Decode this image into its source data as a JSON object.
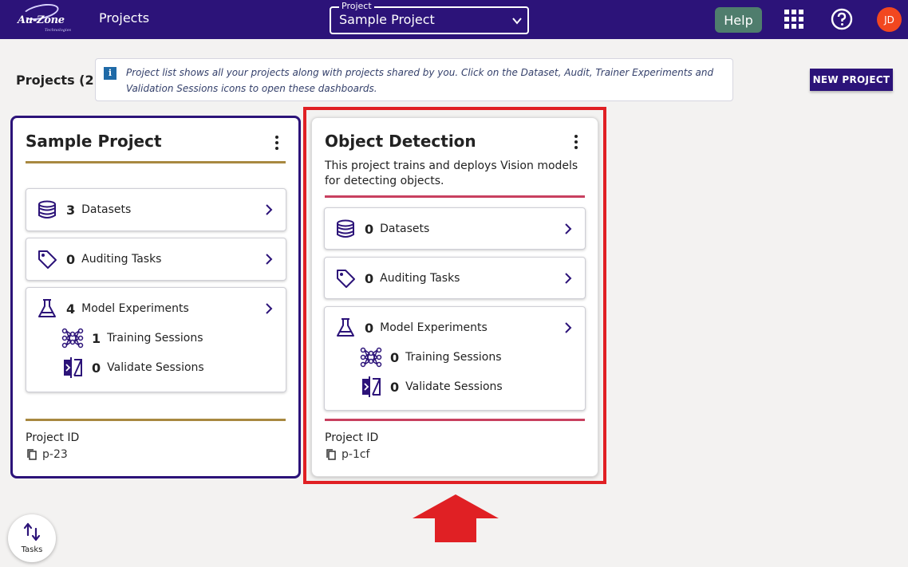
{
  "topbar": {
    "logo_text": "Au-Zone",
    "logo_sub": "Technologies",
    "nav_title": "Projects",
    "project_select_legend": "Project",
    "project_select_value": "Sample Project",
    "help_label": "Help",
    "avatar_initials": "JD",
    "bar_color": "#2c1379",
    "help_color": "#4f7d6d",
    "avatar_color": "#f2471f"
  },
  "header": {
    "projects_count": "Projects (2)",
    "info_text": "Project list shows all your projects along with projects shared by you. Click on the Dataset, Audit, Trainer Experiments and Validation Sessions icons to open these dashboards.",
    "new_project_label": "NEW PROJECT"
  },
  "cards": [
    {
      "title": "Sample Project",
      "description": "",
      "rule_color": "#a88840",
      "datasets": {
        "count": "3",
        "label": "Datasets"
      },
      "auditing": {
        "count": "0",
        "label": "Auditing Tasks"
      },
      "experiments": {
        "count": "4",
        "label": "Model Experiments"
      },
      "training": {
        "count": "1",
        "label": "Training Sessions"
      },
      "validate": {
        "count": "0",
        "label": "Validate Sessions"
      },
      "project_id_label": "Project ID",
      "project_id": "p-23"
    },
    {
      "title": "Object Detection",
      "description": "This project trains and deploys Vision models for detecting objects.",
      "rule_color": "#c8405f",
      "datasets": {
        "count": "0",
        "label": "Datasets"
      },
      "auditing": {
        "count": "0",
        "label": "Auditing Tasks"
      },
      "experiments": {
        "count": "0",
        "label": "Model Experiments"
      },
      "training": {
        "count": "0",
        "label": "Training Sessions"
      },
      "validate": {
        "count": "0",
        "label": "Validate Sessions"
      },
      "project_id_label": "Project ID",
      "project_id": "p-1cf"
    }
  ],
  "tasks_fab": {
    "label": "Tasks"
  },
  "annotation": {
    "highlight_color": "#e02024"
  }
}
